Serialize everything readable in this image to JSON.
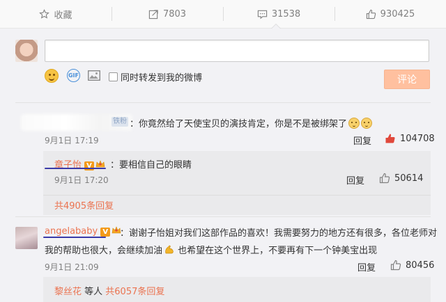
{
  "action_bar": {
    "favorite": {
      "label": "收藏",
      "icon": "star-icon"
    },
    "repost": {
      "count": "7803",
      "icon": "repost-icon"
    },
    "comment": {
      "count": "31538",
      "icon": "comment-icon"
    },
    "like": {
      "count": "930425",
      "icon": "thumbs-up-icon"
    }
  },
  "compose": {
    "repost_checkbox_label": "同时转发到我的微博",
    "submit_label": "评论",
    "submit_color": "#ffc09f"
  },
  "comments": [
    {
      "fan_badge": "铁粉",
      "text": "：你竟然给了天使宝贝的演技肯定，你是不是被绑架了",
      "time": "9月1日 17:19",
      "reply_label": "回复",
      "likes": "104708",
      "replies": [
        {
          "username": "章子怡",
          "verified_badge": "V",
          "text": "：要相信自己的眼睛",
          "time": "9月1日 17:20",
          "reply_label": "回复",
          "likes": "50614"
        }
      ],
      "more_replies": "共4905条回复"
    },
    {
      "username": "angelababy",
      "verified_badge": "V",
      "text_line1": "：谢谢子怡姐对我们这部作品的喜欢！我需要努力的地方还有很多，各位老师对",
      "text_line2a": "我的帮助也很大，会继续加油",
      "text_line2b": " 也希望在这个世界上，不要再有下一个钟美宝出现",
      "time": "9月1日 21:09",
      "reply_label": "回复",
      "likes": "80456",
      "more_replies_user": "黎丝花",
      "more_replies_mid": " 等人 ",
      "more_replies": "共6057条回复"
    }
  ],
  "colors": {
    "accent_orange": "#eb7350",
    "verified_badge": "#f39a1a",
    "like_red": "#e0483b"
  }
}
